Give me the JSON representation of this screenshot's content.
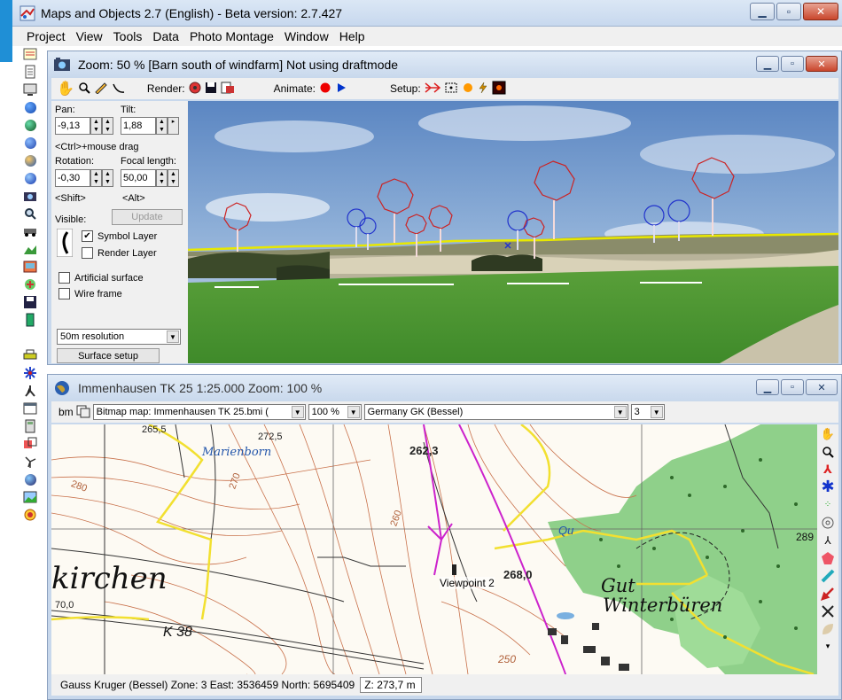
{
  "app": {
    "title": "Maps and Objects 2.7 (English)   -   Beta version: 2.7.427"
  },
  "menu": [
    "Project",
    "View",
    "Tools",
    "Data",
    "Photo Montage",
    "Window",
    "Help"
  ],
  "photo_window": {
    "title": "Zoom: 50 % [Barn south of windfarm]  Not using draftmode",
    "toolbar": {
      "render_label": "Render:",
      "animate_label": "Animate:",
      "setup_label": "Setup:"
    },
    "panel": {
      "pan_label": "Pan:",
      "pan_value": "-9,13",
      "tilt_label": "Tilt:",
      "tilt_value": "1,88",
      "hint_drag": "<Ctrl>+mouse drag",
      "rotation_label": "Rotation:",
      "rotation_value": "-0,30",
      "focal_label": "Focal length:",
      "focal_value": "50,00",
      "hint_shift": "<Shift>",
      "hint_alt": "<Alt>",
      "visible_label": "Visible:",
      "update_label": "Update",
      "symbol_layer_label": "Symbol Layer",
      "symbol_layer_checked": true,
      "render_layer_label": "Render Layer",
      "render_layer_checked": false,
      "artificial_surface_label": "Artificial surface",
      "artificial_surface_checked": false,
      "wire_frame_label": "Wire frame",
      "wire_frame_checked": false,
      "resolution_value": "50m resolution",
      "surface_setup_label": "Surface setup"
    }
  },
  "map_window": {
    "title": "Immenhausen TK 25 1:25.000 Zoom: 100 %",
    "toolbar": {
      "bm_label": "bm",
      "map_combo": "Bitmap map: Immenhausen TK 25.bmi (",
      "zoom_combo": "100 %",
      "projection_combo": "Germany GK (Bessel)",
      "zone_combo": "3"
    },
    "map_labels": {
      "kirchen": "kirchen",
      "marienborn": "Marienborn",
      "gut": "Gut",
      "winterbueren": "Winterbüren",
      "viewpoint": "Viewpoint 2",
      "k38": "K 38",
      "qu": "Qu",
      "e262": "262,3",
      "e268": "268,0",
      "e272": "272,5",
      "e265": "265,5",
      "e270": "270",
      "e280": "280",
      "e260": "260",
      "e250": "250",
      "e289": "289",
      "e70": "70,0"
    },
    "status": {
      "text": "Gauss Kruger (Bessel) Zone: 3  East: 3536459  North: 5695409",
      "z": "Z: 273,7 m"
    }
  },
  "colors": {
    "accent_blue": "#1f8fd6",
    "turbine_red": "#cc2222",
    "turbine_blue": "#2233cc",
    "horizon_yellow": "#e8e800",
    "forest_green": "#8fd08a",
    "track_magenta": "#cc22cc"
  }
}
